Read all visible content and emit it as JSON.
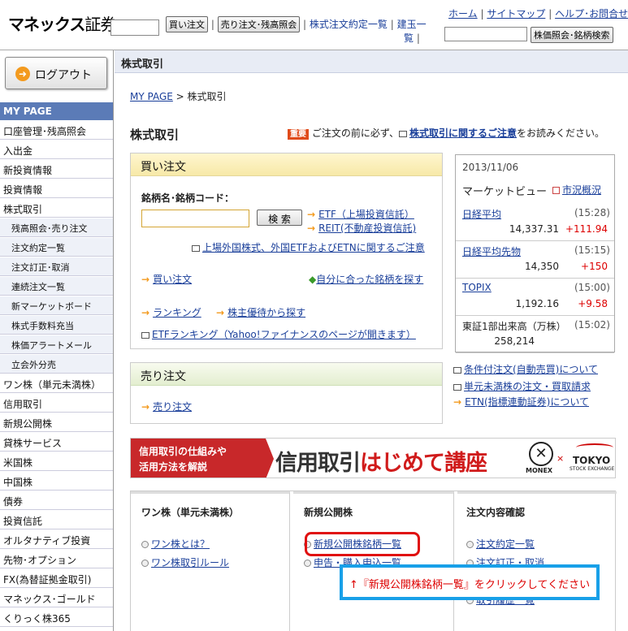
{
  "header": {
    "logo_main": "マネックス",
    "logo_sub": "証券",
    "buy_btn": "買い注文",
    "sell_btn": "売り注文･残高照会",
    "contract_link": "株式注文約定一覧",
    "position_link_1": "建玉一",
    "position_link_2": "覧",
    "home": "ホーム",
    "sitemap": "サイトマップ",
    "help": "ヘルプ･お問合せ",
    "stock_search_btn": "株価照会･銘柄検索"
  },
  "sidebar": {
    "logout": "ログアウト",
    "mypage": "MY PAGE",
    "items": [
      {
        "label": "口座管理･残高照会",
        "sub": false
      },
      {
        "label": "入出金",
        "sub": false
      },
      {
        "label": "新投資情報",
        "sub": false
      },
      {
        "label": "投資情報",
        "sub": false
      },
      {
        "label": "株式取引",
        "sub": false
      },
      {
        "label": "残高照会･売り注文",
        "sub": true
      },
      {
        "label": "注文約定一覧",
        "sub": true
      },
      {
        "label": "注文訂正･取消",
        "sub": true
      },
      {
        "label": "連続注文一覧",
        "sub": true
      },
      {
        "label": "新マーケットボード",
        "sub": true
      },
      {
        "label": "株式手数料充当",
        "sub": true
      },
      {
        "label": "株価アラートメール",
        "sub": true
      },
      {
        "label": "立会外分売",
        "sub": true
      },
      {
        "label": "ワン株（単元未満株）",
        "sub": false
      },
      {
        "label": "信用取引",
        "sub": false
      },
      {
        "label": "新規公開株",
        "sub": false
      },
      {
        "label": "貸株サービス",
        "sub": false
      },
      {
        "label": "米国株",
        "sub": false
      },
      {
        "label": "中国株",
        "sub": false
      },
      {
        "label": "債券",
        "sub": false
      },
      {
        "label": "投資信託",
        "sub": false
      },
      {
        "label": "オルタナティブ投資",
        "sub": false
      },
      {
        "label": "先物･オプション",
        "sub": false
      },
      {
        "label": "FX(為替証拠金取引)",
        "sub": false
      },
      {
        "label": "マネックス･ゴールド",
        "sub": false
      },
      {
        "label": "くりっく株365",
        "sub": false
      }
    ]
  },
  "breadcrumb_bar": "株式取引",
  "breadcrumb": {
    "mypage": "MY PAGE",
    "sep": " > ",
    "current": "株式取引"
  },
  "page_title": "株式取引",
  "notice": {
    "badge": "重要",
    "text1": "ご注文の前に必ず、",
    "link": "株式取引に関するご注意",
    "text2": "をお読みください。"
  },
  "buy_box": {
    "title": "買い注文",
    "field_label": "銘柄名･銘柄コード：",
    "search_btn": "検 索",
    "etf_link": "ETF（上場投資信託）",
    "reit_link": "REIT(不動産投資信託)",
    "foreign_note": "上場外国株式、外国ETFおよびETNに関するご注意",
    "buy_order": "買い注文",
    "find_suitable": "自分に合った銘柄を探す",
    "ranking": "ランキング",
    "yutai": "株主優待から探す",
    "etf_ranking": "ETFランキング（Yahoo!ファイナンスのページが開きます）"
  },
  "sell_box": {
    "title": "売り注文",
    "sell_order": "売り注文"
  },
  "market": {
    "date": "2013/11/06",
    "title": "マーケットビュー",
    "overview": "市況概況",
    "rows": [
      {
        "name": "日経平均",
        "time": "(15:28)",
        "value": "14,337.31",
        "change": "+111.94"
      },
      {
        "name": "日経平均先物",
        "time": "(15:15)",
        "value": "14,350",
        "change": "+150"
      },
      {
        "name": "TOPIX",
        "time": "(15:00)",
        "value": "1,192.16",
        "change": "+9.58"
      },
      {
        "name": "東証1部出来高（万株）",
        "time": "(15:02)",
        "value": "258,214",
        "change": ""
      }
    ]
  },
  "side_links": [
    "条件付注文(自動売買)について",
    "単元未満株の注文・買取請求",
    "ETN(指標連動証券)について"
  ],
  "banner": {
    "left_line1": "信用取引の仕組みや",
    "left_line2": "活用方法を解説",
    "main1": "信用取引",
    "main2": "はじめて講座",
    "monex": "MONEX",
    "tokyo": "TOKYO",
    "tokyo_sub": "STOCK EXCHANGE"
  },
  "cols": [
    {
      "title": "ワン株（単元未満株）",
      "links": [
        "ワン株とは？",
        "ワン株取引ルール"
      ]
    },
    {
      "title": "新規公開株",
      "links": [
        "新規公開株銘柄一覧",
        "申告・購入申込一覧"
      ]
    },
    {
      "title": "注文内容確認",
      "links": [
        "注文約定一覧",
        "注文訂正・取消",
        "取引履歴一覧"
      ]
    }
  ],
  "callout": "↑『新規公開株銘柄一覧』をクリックしてください"
}
